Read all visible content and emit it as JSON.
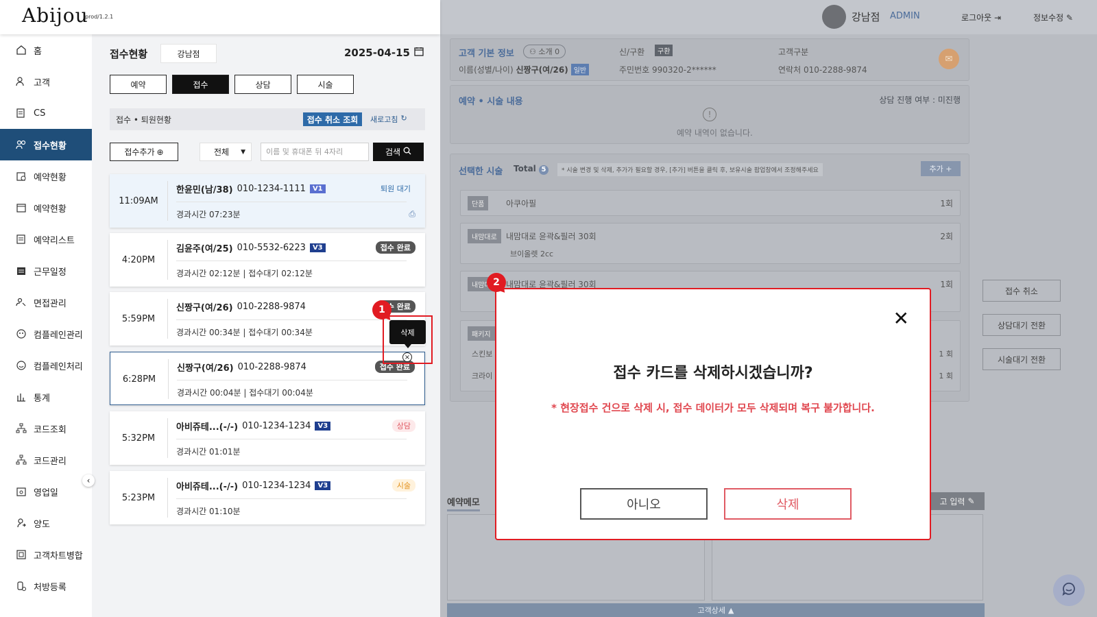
{
  "app": {
    "logo": "Abijou",
    "version": "prod/1.2.1"
  },
  "sidebar": {
    "items": [
      {
        "label": "홈",
        "icon": "home-icon"
      },
      {
        "label": "고객",
        "icon": "users-icon"
      },
      {
        "label": "CS",
        "icon": "cs-icon"
      },
      {
        "label": "접수현황",
        "icon": "reception-icon",
        "active": true
      },
      {
        "label": "예약현황",
        "icon": "calendar-clock-icon"
      },
      {
        "label": "예약현황",
        "icon": "calendar-icon"
      },
      {
        "label": "예약리스트",
        "icon": "list-icon"
      },
      {
        "label": "근무일정",
        "icon": "schedule-icon"
      },
      {
        "label": "면접관리",
        "icon": "interview-icon"
      },
      {
        "label": "컴플레인관리",
        "icon": "complaint-icon"
      },
      {
        "label": "컴플레인처리",
        "icon": "smile-icon"
      },
      {
        "label": "통계",
        "icon": "chart-icon"
      },
      {
        "label": "코드조회",
        "icon": "tree-icon"
      },
      {
        "label": "코드관리",
        "icon": "tree-icon"
      },
      {
        "label": "영업일",
        "icon": "business-day-icon"
      },
      {
        "label": "양도",
        "icon": "transfer-icon"
      },
      {
        "label": "고객차트병합",
        "icon": "merge-icon"
      },
      {
        "label": "처방등록",
        "icon": "prescription-icon"
      }
    ]
  },
  "reception": {
    "title": "접수현황",
    "branch": "강남점",
    "date": "2025-04-15",
    "tabs": [
      "예약",
      "접수",
      "상담",
      "시술"
    ],
    "section_title": "접수 • 퇴원현황",
    "cancel_lookup": "접수 취소 조회",
    "refresh": "새로고침",
    "add_label": "접수추가",
    "filter_value": "전체",
    "search_placeholder": "이름 및 휴대폰 뒤 4자리",
    "search_label": "검색",
    "cards": [
      {
        "time": "11:09AM",
        "name": "한윤민(남/38)",
        "phone": "010-1234-1111",
        "visit": "V1",
        "status": "퇴원 대기",
        "sub": "경과시간 07:23분"
      },
      {
        "time": "4:20PM",
        "name": "김윤주(여/25)",
        "phone": "010-5532-6223",
        "visit": "V3",
        "status": "접수 완료",
        "sub": "경과시간 02:12분 | 접수대기 02:12분"
      },
      {
        "time": "5:59PM",
        "name": "신짱구(여/26)",
        "phone": "010-2288-9874",
        "visit": "",
        "status": "접수 완료",
        "sub": "경과시간 00:34분 | 접수대기 00:34분"
      },
      {
        "time": "6:28PM",
        "name": "신짱구(여/26)",
        "phone": "010-2288-9874",
        "visit": "",
        "status": "접수 완료",
        "sub": "경과시간 00:04분 | 접수대기 00:04분"
      },
      {
        "time": "5:32PM",
        "name": "아비쥬테...(-/-)",
        "phone": "010-1234-1234",
        "visit": "V3",
        "status": "상담",
        "sub": "경과시간 01:01분"
      },
      {
        "time": "5:23PM",
        "name": "아비쥬테...(-/-)",
        "phone": "010-1234-1234",
        "visit": "V3",
        "status": "시술",
        "sub": "경과시간 01:10분"
      }
    ],
    "tooltip_delete": "삭제"
  },
  "markers": [
    "1",
    "2"
  ],
  "top_right": {
    "branch": "강남점",
    "role": "ADMIN",
    "logout": "로그아웃",
    "edit": "정보수정"
  },
  "customer": {
    "title": "고객 기본 정보",
    "referral": "소개 0",
    "name_label": "이름(성별/나이)",
    "name_value": "신짱구(여/26)",
    "grade": "일반",
    "newold_label": "신/구환",
    "newold_value": "구환",
    "ssn_label": "주민번호",
    "ssn_value": "990320-2******",
    "type_label": "고객구분",
    "contact_label": "연락처",
    "contact_value": "010-2288-9874"
  },
  "booking": {
    "title": "예약 • 시술 내용",
    "progress": "상담 진행 여부 : 미진행",
    "empty": "예약 내역이 없습니다."
  },
  "treatments": {
    "title": "선택한 시술",
    "total_label": "Total",
    "total_count": "5",
    "note": "* 시술 변경 및 삭제, 추가가 필요할 경우, [추가] 버튼을 클릭 후, 보유시술 팝업창에서 조정해주세요",
    "add": "추가 +",
    "items": [
      {
        "tag": "단품",
        "name": "아쿠아필",
        "count": "1회"
      },
      {
        "tag": "내맘대로",
        "name": "내맘대로 윤곽&필러 30회",
        "sub": "브이올렛 2cc",
        "count": "2회"
      },
      {
        "tag": "내맘대로",
        "name": "내맘대로 윤곽&필러 30회",
        "count": "1회"
      }
    ],
    "package": {
      "tag": "패키지",
      "rows": [
        {
          "name": "스킨보",
          "count": "1 회"
        },
        {
          "name": "크라이",
          "count": "1 회"
        }
      ]
    }
  },
  "memo": {
    "label": "예약메모",
    "input_label": "고 입력"
  },
  "customer_detail": "고객상세",
  "side_actions": [
    "접수 취소",
    "상담대기 전환",
    "시술대기 전환"
  ],
  "modal": {
    "title": "접수 카드를 삭제하시겠습니까?",
    "warning": "* 현장접수 건으로 삭제 시, 접수 데이터가 모두 삭제되며 복구 불가합니다.",
    "no": "아니오",
    "yes": "삭제"
  }
}
